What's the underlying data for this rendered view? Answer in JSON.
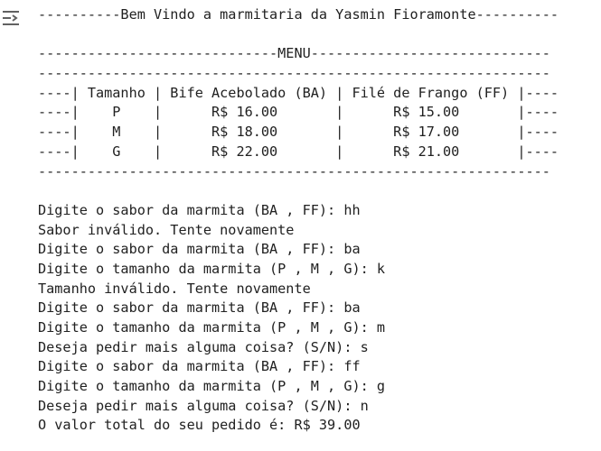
{
  "output_icon": "output-redirect-icon",
  "lines": [
    "----------Bem Vindo a marmitaria da Yasmin Fioramonte----------",
    "",
    "-----------------------------MENU-----------------------------",
    "--------------------------------------------------------------",
    "----| Tamanho | Bife Acebolado (BA) | Filé de Frango (FF) |----",
    "----|    P    |      R$ 16.00       |      R$ 15.00       |----",
    "----|    M    |      R$ 18.00       |      R$ 17.00       |----",
    "----|    G    |      R$ 22.00       |      R$ 21.00       |----",
    "--------------------------------------------------------------",
    "",
    "Digite o sabor da marmita (BA , FF): hh",
    "Sabor inválido. Tente novamente",
    "Digite o sabor da marmita (BA , FF): ba",
    "Digite o tamanho da marmita (P , M , G): k",
    "Tamanho inválido. Tente novamente",
    "Digite o sabor da marmita (BA , FF): ba",
    "Digite o tamanho da marmita (P , M , G): m",
    "Deseja pedir mais alguma coisa? (S/N): s",
    "Digite o sabor da marmita (BA , FF): ff",
    "Digite o tamanho da marmita (P , M , G): g",
    "Deseja pedir mais alguma coisa? (S/N): n",
    "O valor total do seu pedido é: R$ 39.00"
  ]
}
